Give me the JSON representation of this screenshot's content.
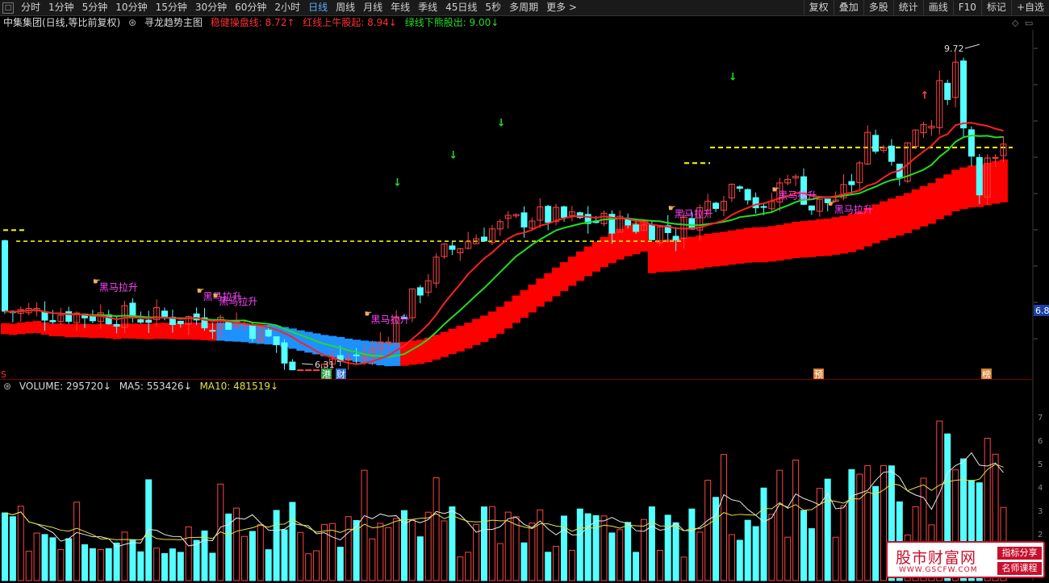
{
  "toolbar": {
    "periods": [
      "分时",
      "1分钟",
      "5分钟",
      "10分钟",
      "15分钟",
      "30分钟",
      "60分钟",
      "2小时",
      "日线",
      "周线",
      "月线",
      "年线",
      "季线",
      "45日线",
      "5秒",
      "多周期",
      "更多 >"
    ],
    "active_period": "日线",
    "right_buttons": [
      "复权",
      "叠加",
      "多股",
      "统计",
      "画线",
      "F10",
      "标记",
      "+自选"
    ]
  },
  "info": {
    "stock": "中集集团(日线,等比前复权)",
    "indicator": "寻龙趋势主图",
    "stable_line": "稳健操盘线: 8.72↑",
    "red_line": "红线上牛股起: 8.94↓",
    "green_line": "绿线下熊股出: 9.00↓"
  },
  "volume_info": {
    "volume": "VOLUME: 295720↓",
    "ma5": "MA5: 553426↓",
    "ma10": "MA10: 481519↓"
  },
  "colors": {
    "up": "#ff4444",
    "down": "#54ffff",
    "ma_red": "#ff2020",
    "ma_green": "#22dd22",
    "band": "#ff0000",
    "band_blue": "#1e90ff",
    "dash": "#ffff00",
    "signal": "#ff44ff"
  },
  "price": {
    "high_label": "9.72",
    "low_label": "6.31",
    "right_tag": "6.8",
    "signal_text": "黑马拉升",
    "corner_marker": "S"
  },
  "event_markers": [
    {
      "text": "港",
      "color": "#2ea043"
    },
    {
      "text": "财",
      "color": "#2f6fcc"
    },
    {
      "text": "预",
      "color": "#d08030"
    },
    {
      "text": "榜",
      "color": "#d08030"
    }
  ],
  "volume_scale": [
    "7",
    "6",
    "5",
    "4",
    "3",
    "2"
  ],
  "watermark": {
    "main": "股市财富网",
    "url": "WWW.GSCFW.COM",
    "tag1": "指标分享",
    "tag2": "名师课程"
  }
}
